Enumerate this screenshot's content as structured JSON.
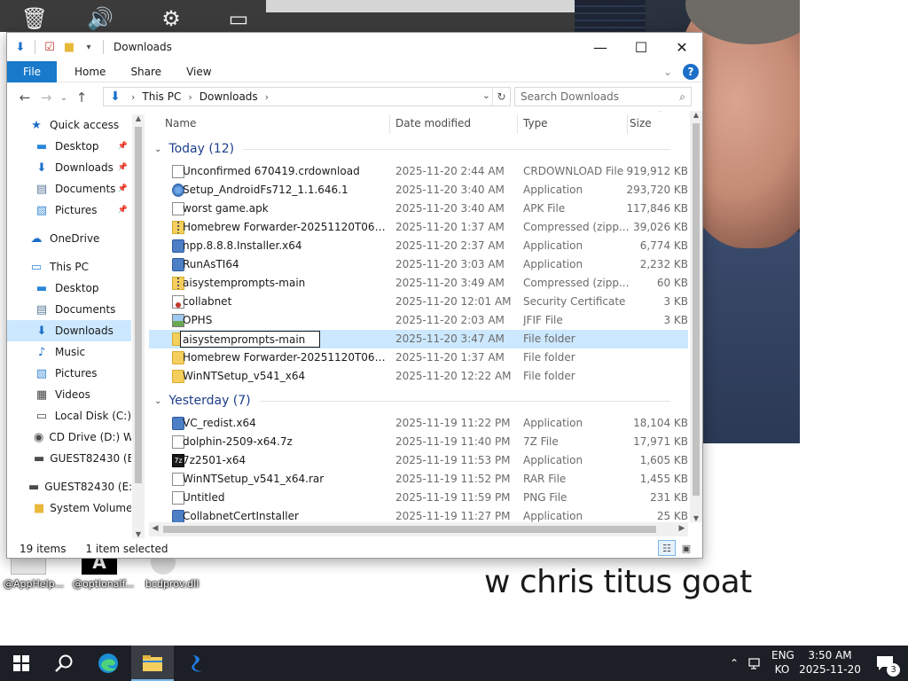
{
  "window": {
    "title": "Downloads",
    "controls": {
      "minimize": "—",
      "maximize": "☐",
      "close": "✕"
    }
  },
  "ribbon": {
    "file": "File",
    "tabs": [
      "Home",
      "Share",
      "View"
    ],
    "help": "?"
  },
  "address": {
    "crumbs": [
      "This PC",
      "Downloads"
    ],
    "search_placeholder": "Search Downloads"
  },
  "nav_pane": {
    "items": [
      {
        "label": "Quick access",
        "icon": "star-icon",
        "color": "#1c6fc9",
        "indent": 1
      },
      {
        "label": "Desktop",
        "icon": "desktop-icon",
        "color": "#2b86d9",
        "indent": 2,
        "pinned": true
      },
      {
        "label": "Downloads",
        "icon": "download-arrow-icon",
        "color": "#1c6fc9",
        "indent": 2,
        "pinned": true
      },
      {
        "label": "Documents",
        "icon": "documents-icon",
        "color": "#5a7a99",
        "indent": 2,
        "pinned": true
      },
      {
        "label": "Pictures",
        "icon": "pictures-icon",
        "color": "#3d8bd4",
        "indent": 2,
        "pinned": true
      },
      {
        "label": "OneDrive",
        "icon": "cloud-icon",
        "color": "#1c6fc9",
        "indent": 1
      },
      {
        "label": "This PC",
        "icon": "computer-icon",
        "color": "#2b86d9",
        "indent": 1
      },
      {
        "label": "Desktop",
        "icon": "desktop-icon",
        "color": "#2b86d9",
        "indent": 2
      },
      {
        "label": "Documents",
        "icon": "documents-icon",
        "color": "#5a7a99",
        "indent": 2
      },
      {
        "label": "Downloads",
        "icon": "download-arrow-icon",
        "color": "#1c6fc9",
        "indent": 2,
        "selected": true
      },
      {
        "label": "Music",
        "icon": "music-icon",
        "color": "#1c6fc9",
        "indent": 2
      },
      {
        "label": "Pictures",
        "icon": "pictures-icon",
        "color": "#3d8bd4",
        "indent": 2
      },
      {
        "label": "Videos",
        "icon": "videos-icon",
        "color": "#444444",
        "indent": 2
      },
      {
        "label": "Local Disk (C:)",
        "icon": "drive-icon",
        "color": "#4b4b4b",
        "indent": 2
      },
      {
        "label": "CD Drive (D:) WI",
        "icon": "cd-drive-icon",
        "color": "#4b4b4b",
        "indent": 2
      },
      {
        "label": "GUEST82430 (E:)",
        "icon": "usb-drive-icon",
        "color": "#4b4b4b",
        "indent": 2
      },
      {
        "label": "GUEST82430 (E:)",
        "icon": "usb-drive-icon",
        "color": "#4b4b4b",
        "indent": 1
      },
      {
        "label": "System Volume I",
        "icon": "folder-icon",
        "color": "#e8b83a",
        "indent": 2
      }
    ]
  },
  "columns": {
    "name": "Name",
    "date": "Date modified",
    "type": "Type",
    "size": "Size"
  },
  "groups": [
    {
      "label": "Today (12)",
      "rows": [
        {
          "name": "Unconfirmed 670419.crdownload",
          "date": "2025-11-20 2:44 AM",
          "type": "CRDOWNLOAD File",
          "size": "919,912 KB",
          "icon": "ic-doc"
        },
        {
          "name": "Setup_AndroidFs712_1.1.646.1",
          "date": "2025-11-20 3:40 AM",
          "type": "Application",
          "size": "293,720 KB",
          "icon": "ic-setup"
        },
        {
          "name": "worst game.apk",
          "date": "2025-11-20 3:40 AM",
          "type": "APK File",
          "size": "117,846 KB",
          "icon": "ic-doc"
        },
        {
          "name": "Homebrew Forwarder-20251120T064251Z...",
          "date": "2025-11-20 1:37 AM",
          "type": "Compressed (zipp...",
          "size": "39,026 KB",
          "icon": "ic-zip"
        },
        {
          "name": "npp.8.8.8.Installer.x64",
          "date": "2025-11-20 2:37 AM",
          "type": "Application",
          "size": "6,774 KB",
          "icon": "ic-app"
        },
        {
          "name": "RunAsTI64",
          "date": "2025-11-20 3:03 AM",
          "type": "Application",
          "size": "2,232 KB",
          "icon": "ic-app"
        },
        {
          "name": "aisystemprompts-main",
          "date": "2025-11-20 3:49 AM",
          "type": "Compressed (zipp...",
          "size": "60 KB",
          "icon": "ic-zip"
        },
        {
          "name": "collabnet",
          "date": "2025-11-20 12:01 AM",
          "type": "Security Certificate",
          "size": "3 KB",
          "icon": "ic-cert"
        },
        {
          "name": "OPHS",
          "date": "2025-11-20 2:03 AM",
          "type": "JFIF File",
          "size": "3 KB",
          "icon": "ic-img"
        },
        {
          "name": "aisystemprompts-main",
          "date": "2025-11-20 3:47 AM",
          "type": "File folder",
          "size": "",
          "icon": "ic-folder",
          "selected": true,
          "renaming": true
        },
        {
          "name": "Homebrew Forwarder-20251120T064251Z...",
          "date": "2025-11-20 1:37 AM",
          "type": "File folder",
          "size": "",
          "icon": "ic-folder"
        },
        {
          "name": "WinNTSetup_v541_x64",
          "date": "2025-11-20 12:22 AM",
          "type": "File folder",
          "size": "",
          "icon": "ic-folder"
        }
      ]
    },
    {
      "label": "Yesterday (7)",
      "rows": [
        {
          "name": "VC_redist.x64",
          "date": "2025-11-19 11:22 PM",
          "type": "Application",
          "size": "18,104 KB",
          "icon": "ic-app"
        },
        {
          "name": "dolphin-2509-x64.7z",
          "date": "2025-11-19 11:40 PM",
          "type": "7Z File",
          "size": "17,971 KB",
          "icon": "ic-doc"
        },
        {
          "name": "7z2501-x64",
          "date": "2025-11-19 11:53 PM",
          "type": "Application",
          "size": "1,605 KB",
          "icon": "ic-7z"
        },
        {
          "name": "WinNTSetup_v541_x64.rar",
          "date": "2025-11-19 11:52 PM",
          "type": "RAR File",
          "size": "1,455 KB",
          "icon": "ic-doc"
        },
        {
          "name": "Untitled",
          "date": "2025-11-19 11:59 PM",
          "type": "PNG File",
          "size": "231 KB",
          "icon": "ic-doc"
        },
        {
          "name": "CollabnetCertInstaller",
          "date": "2025-11-19 11:27 PM",
          "type": "Application",
          "size": "25 KB",
          "icon": "ic-app"
        }
      ]
    }
  ],
  "status": {
    "count": "19 items",
    "selection": "1 item selected"
  },
  "desktop": {
    "caption": "w chris titus goat",
    "icons": [
      "@AppHelp...",
      "@optionalf...",
      "bcdprov.dll"
    ]
  },
  "taskbar": {
    "lang_top": "ENG",
    "lang_bottom": "KO",
    "time": "3:50 AM",
    "date": "2025-11-20",
    "notifications": "3",
    "accent": "#76b9ed"
  }
}
